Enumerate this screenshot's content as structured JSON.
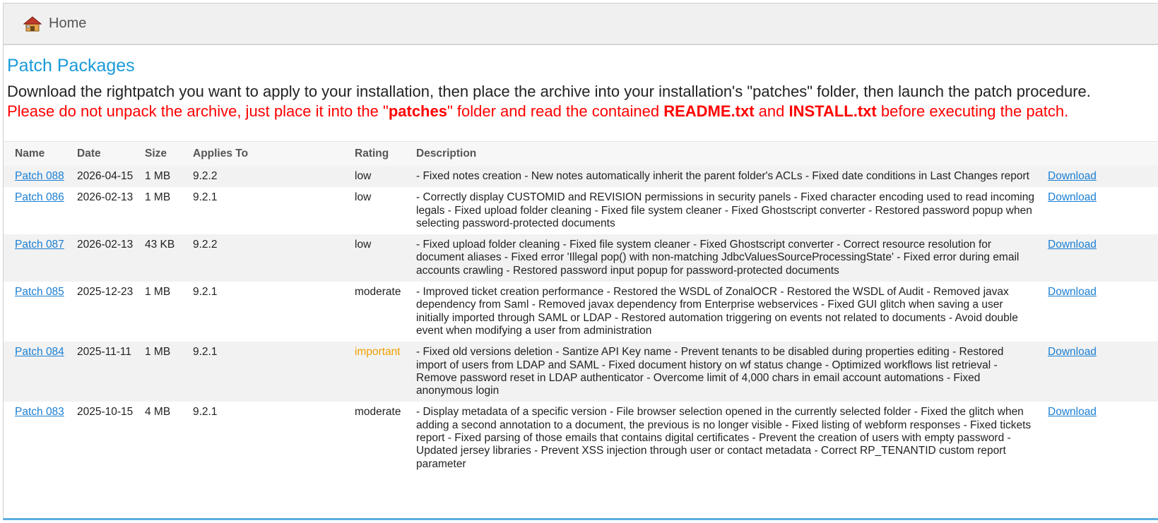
{
  "header": {
    "home_label": "Home",
    "home_icon": "home-icon"
  },
  "page": {
    "title": "Patch Packages",
    "intro": "Download the rightpatch you want to apply to your installation, then place the archive into your installation's \"patches\" folder, then launch the patch procedure.",
    "warning": {
      "part1": "Please do not unpack the archive, just place it into the \"",
      "bold1": "patches",
      "part2": "\" folder and read the contained ",
      "bold2": "README.txt",
      "part3": " and ",
      "bold3": "INSTALL.txt",
      "part4": " before executing the patch."
    },
    "colors": {
      "title": "#1a9ad9",
      "warning": "#ff0000",
      "link": "#1a7fd4",
      "important": "#f0a000"
    }
  },
  "table": {
    "columns": [
      "Name",
      "Date",
      "Size",
      "Applies To",
      "Rating",
      "Description"
    ],
    "rows": [
      {
        "name": "Patch 088",
        "date": "2026-04-15",
        "size": "1 MB",
        "applies_to": "9.2.2",
        "rating": "low",
        "description": "- Fixed notes creation - New notes automatically inherit the parent folder's ACLs - Fixed date conditions in Last Changes report",
        "download": "Download"
      },
      {
        "name": "Patch 086",
        "date": "2026-02-13",
        "size": "1 MB",
        "applies_to": "9.2.1",
        "rating": "low",
        "description": "- Correctly display CUSTOMID and REVISION permissions in security panels - Fixed character encoding used to read incoming legals - Fixed upload folder cleaning - Fixed file system cleaner - Fixed Ghostscript converter - Restored password popup when selecting password-protected documents",
        "download": "Download"
      },
      {
        "name": "Patch 087",
        "date": "2026-02-13",
        "size": "43 KB",
        "applies_to": "9.2.2",
        "rating": "low",
        "description": "- Fixed upload folder cleaning - Fixed file system cleaner - Fixed Ghostscript converter - Correct resource resolution for document aliases - Fixed error 'Illegal pop() with non-matching JdbcValuesSourceProcessingState' - Fixed error during email accounts crawling - Restored password input popup for password-protected documents",
        "download": "Download"
      },
      {
        "name": "Patch 085",
        "date": "2025-12-23",
        "size": "1 MB",
        "applies_to": "9.2.1",
        "rating": "moderate",
        "description": "- Improved ticket creation performance - Restored the WSDL of ZonalOCR - Restored the WSDL of Audit - Removed javax dependency from Saml - Removed javax dependency from Enterprise webservices - Fixed GUI glitch when saving a user initially imported through SAML or LDAP - Restored automation triggering on events not related to documents - Avoid double event when modifying a user from administration",
        "download": "Download"
      },
      {
        "name": "Patch 084",
        "date": "2025-11-11",
        "size": "1 MB",
        "applies_to": "9.2.1",
        "rating": "important",
        "description": "- Fixed old versions deletion - Santize API Key name - Prevent tenants to be disabled during properties editing - Restored import of users from LDAP and SAML - Fixed document history on wf status change - Optimized workflows list retrieval - Remove password reset in LDAP authenticator - Overcome limit of 4,000 chars in email account automations - Fixed anonymous login",
        "download": "Download"
      },
      {
        "name": "Patch 083",
        "date": "2025-10-15",
        "size": "4 MB",
        "applies_to": "9.2.1",
        "rating": "moderate",
        "description": "- Display metadata of a specific version - File browser selection opened in the currently selected folder - Fixed the glitch when adding a second annotation to a document, the previous is no longer visible - Fixed listing of webform responses - Fixed tickets report - Fixed parsing of those emails that contains digital certificates - Prevent the creation of users with empty password - Updated jersey libraries - Prevent XSS injection through user or contact metadata - Correct RP_TENANTID custom report parameter",
        "download": "Download"
      }
    ]
  }
}
